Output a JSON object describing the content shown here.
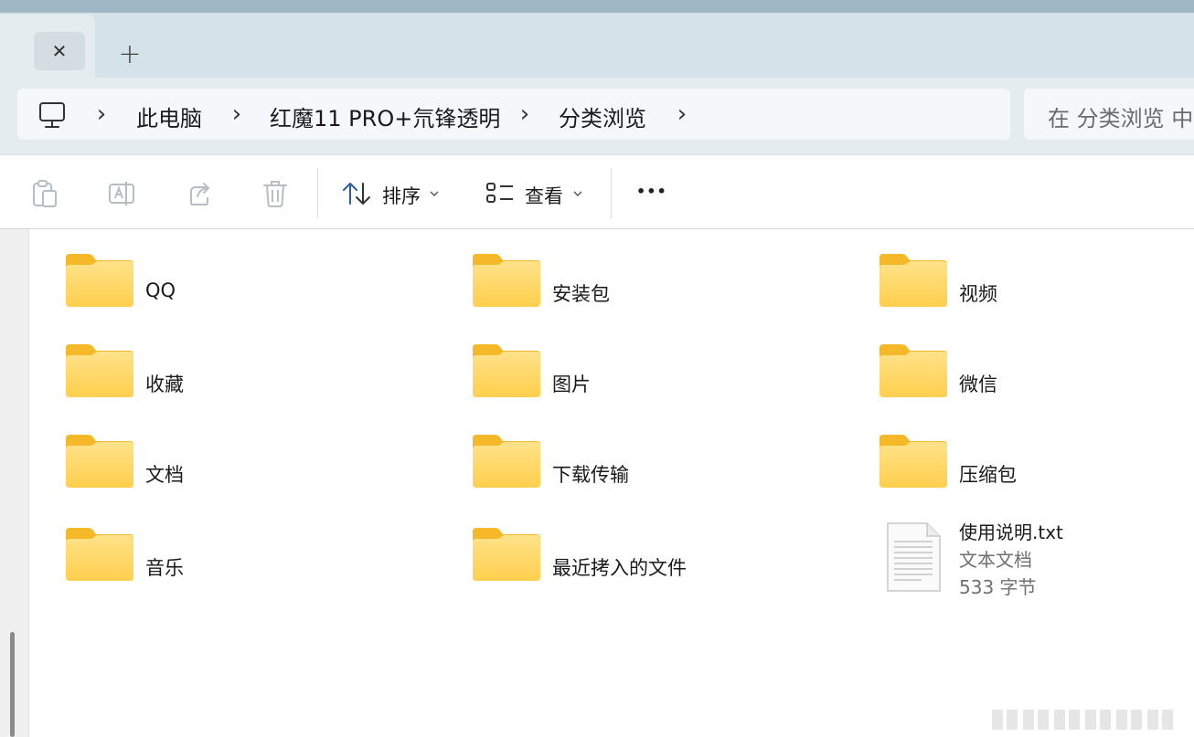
{
  "window": {
    "close_glyph": "✕",
    "new_tab_glyph": "+"
  },
  "breadcrumb": {
    "root_icon": "computer-icon",
    "items": [
      {
        "label": "此电脑"
      },
      {
        "label": "红魔11 PRO+氘锋透明"
      },
      {
        "label": "分类浏览"
      }
    ],
    "separator": "›"
  },
  "search": {
    "placeholder": "在 分类浏览 中搜索"
  },
  "toolbar": {
    "icons": [
      "paste-icon",
      "rename-icon",
      "share-icon",
      "delete-icon"
    ],
    "sort_label": "排序",
    "view_label": "查看",
    "more_glyph": "•••"
  },
  "items": [
    {
      "name": "QQ",
      "type": "folder"
    },
    {
      "name": "安装包",
      "type": "folder"
    },
    {
      "name": "视频",
      "type": "folder"
    },
    {
      "name": "收藏",
      "type": "folder"
    },
    {
      "name": "图片",
      "type": "folder"
    },
    {
      "name": "微信",
      "type": "folder"
    },
    {
      "name": "文档",
      "type": "folder"
    },
    {
      "name": "下载传输",
      "type": "folder"
    },
    {
      "name": "压缩包",
      "type": "folder"
    },
    {
      "name": "音乐",
      "type": "folder"
    },
    {
      "name": "最近拷入的文件",
      "type": "folder"
    }
  ],
  "file": {
    "name": "使用说明.txt",
    "type_label": "文本文档",
    "size_label": "533 字节"
  },
  "colors": {
    "folder_front": "#ffd96a",
    "folder_back": "#f5b829",
    "tabbar": "#d5e2e9",
    "navbar": "#e4ecf0"
  }
}
